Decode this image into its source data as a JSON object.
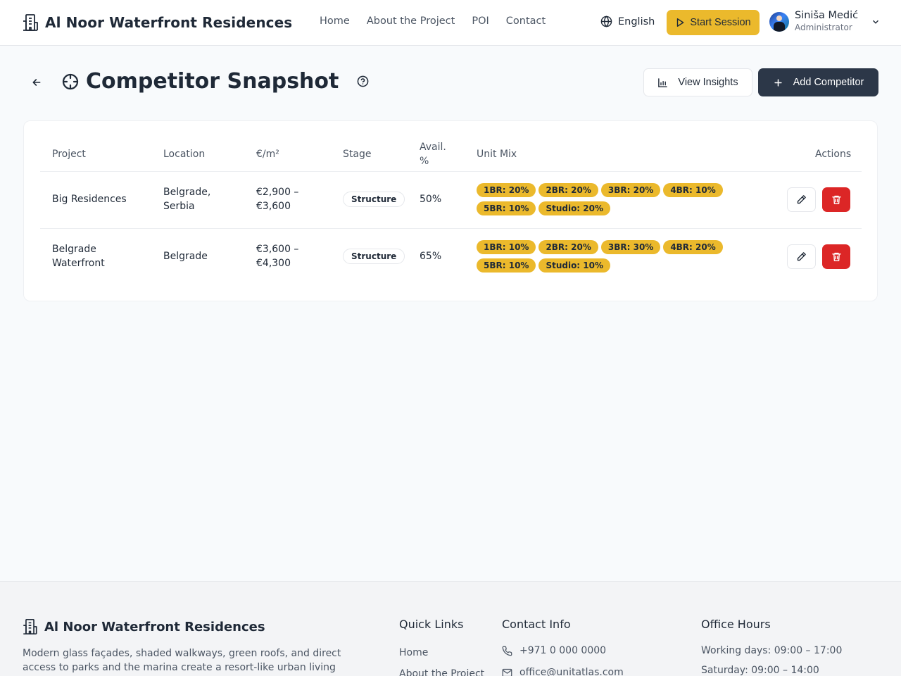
{
  "header": {
    "brand": "Al Noor Waterfront Residences",
    "nav": [
      "Home",
      "About the Project",
      "POI",
      "Contact"
    ],
    "language": "English",
    "start_session": "Start Session",
    "user_name": "Siniša Medić",
    "user_role": "Administrator"
  },
  "page": {
    "title": "Competitor Snapshot",
    "view_insights": "View Insights",
    "add_competitor": "Add Competitor"
  },
  "table": {
    "headers": {
      "project": "Project",
      "location": "Location",
      "price": "€/m²",
      "stage": "Stage",
      "avail_1": "Avail.",
      "avail_2": "%",
      "unit_mix": "Unit Mix",
      "actions": "Actions"
    },
    "rows": [
      {
        "project": "Big Residences",
        "location_1": "Belgrade,",
        "location_2": "Serbia",
        "price_1": "€2,900 –",
        "price_2": "€3,600",
        "stage": "Structure",
        "avail": "50%",
        "mix": [
          "1BR: 20%",
          "2BR: 20%",
          "3BR: 20%",
          "4BR: 10%",
          "5BR: 10%",
          "Studio: 20%"
        ]
      },
      {
        "project_1": "Belgrade",
        "project_2": "Waterfront",
        "location": "Belgrade",
        "price_1": "€3,600 –",
        "price_2": "€4,300",
        "stage": "Structure",
        "avail": "65%",
        "mix": [
          "1BR: 10%",
          "2BR: 20%",
          "3BR: 30%",
          "4BR: 20%",
          "5BR: 10%",
          "Studio: 10%"
        ]
      }
    ]
  },
  "footer": {
    "brand": "Al Noor Waterfront Residences",
    "description": "Modern glass façades, shaded walkways, green roofs, and direct access to parks and the marina create a resort-like urban living experience.",
    "quick_links_title": "Quick Links",
    "quick_links": [
      "Home",
      "About the Project"
    ],
    "contact_title": "Contact Info",
    "phone": "+971 0 000 0000",
    "email": "office@unitatlas.com",
    "hours_title": "Office Hours",
    "hours": [
      "Working days: 09:00 – 17:00",
      "Saturday: 09:00 – 14:00"
    ]
  },
  "colors": {
    "accent": "#ebb92c",
    "primary_dark": "#2c3748",
    "danger": "#dc2626",
    "background": "#f8fafc"
  },
  "icons": {
    "brand": "building-icon",
    "language": "globe-icon",
    "start": "play-icon",
    "user_menu": "chevron-down-icon",
    "back": "arrow-left-icon",
    "title": "crosshair-icon",
    "help": "help-circle-icon",
    "insights": "bar-chart-icon",
    "add": "plus-icon",
    "edit": "pencil-icon",
    "delete": "trash-icon",
    "phone": "phone-icon",
    "email": "mail-icon"
  }
}
